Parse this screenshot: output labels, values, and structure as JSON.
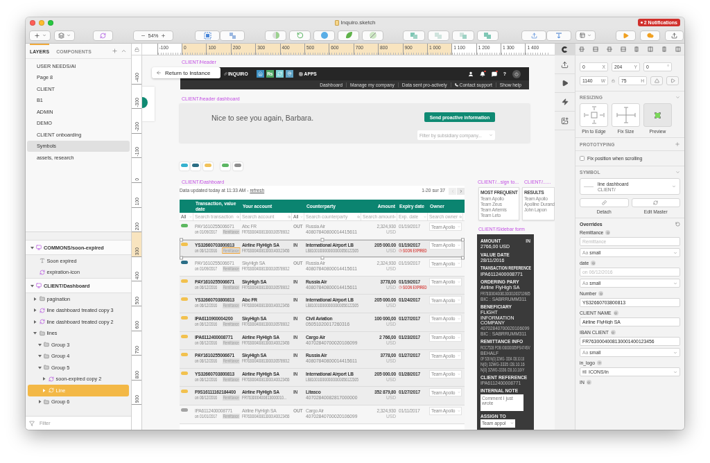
{
  "window": {
    "title": "Inquiro.sketch",
    "notifications": "2 Notifications"
  },
  "toolbar": {
    "zoom": "54%"
  },
  "layers_panel": {
    "tabs": [
      {
        "label": "LAYERS",
        "selected": true
      },
      {
        "label": "COMPONENTS",
        "selected": false
      }
    ],
    "pages": [
      {
        "label": "USER NEEDS/AI",
        "selected": false
      },
      {
        "label": "Page 8",
        "selected": false
      },
      {
        "label": "CLIENT",
        "selected": false
      },
      {
        "label": "B1",
        "selected": false
      },
      {
        "label": "ADMIN",
        "selected": false
      },
      {
        "label": "DEMO",
        "selected": false
      },
      {
        "label": "CLIENT onboarding",
        "selected": false
      },
      {
        "label": "Symbols",
        "selected": true
      },
      {
        "label": "assets, research",
        "selected": false
      }
    ],
    "layers": [
      {
        "label": "COMMONS/soon-expired",
        "kind": "artboard",
        "expanded": true,
        "selected": false,
        "children": [
          {
            "label": "Soon expired",
            "kind": "text",
            "selected": false
          },
          {
            "label": "expiration-icon",
            "kind": "symbol",
            "selected": false
          }
        ]
      },
      {
        "label": "CLIENT/Dashboard",
        "kind": "artboard",
        "expanded": true,
        "selected": false,
        "children": [
          {
            "label": "pagination",
            "kind": "group",
            "expanded": false,
            "selected": false
          },
          {
            "label": "line dashboard treated copy 3",
            "kind": "symbol",
            "expanded": false,
            "selected": false
          },
          {
            "label": "line dashboard treated copy 2",
            "kind": "symbol",
            "expanded": false,
            "selected": false
          },
          {
            "label": "lines",
            "kind": "group",
            "expanded": true,
            "selected": false,
            "children": [
              {
                "label": "Group 3",
                "kind": "group",
                "expanded": true,
                "selected": false
              },
              {
                "label": "Group 4",
                "kind": "group",
                "expanded": true,
                "selected": false
              },
              {
                "label": "Group 5",
                "kind": "group",
                "expanded": true,
                "selected": false,
                "children": [
                  {
                    "label": "soon-expired copy 2",
                    "kind": "symbol",
                    "expanded": false,
                    "selected": false
                  },
                  {
                    "label": "Line",
                    "kind": "symbol",
                    "expanded": false,
                    "selected": true
                  }
                ]
              },
              {
                "label": "Group 6",
                "kind": "group",
                "expanded": false,
                "selected": false
              }
            ]
          }
        ]
      }
    ],
    "filter": {
      "placeholder": "Filter"
    }
  },
  "rulers": {
    "horizontal": [
      {
        "label": "-100",
        "highlighted": false
      },
      {
        "label": "0",
        "highlighted": true
      },
      {
        "label": "100",
        "highlighted": true
      },
      {
        "label": "200",
        "highlighted": true
      },
      {
        "label": "300",
        "highlighted": true
      },
      {
        "label": "400",
        "highlighted": true
      },
      {
        "label": "500",
        "highlighted": true
      },
      {
        "label": "600",
        "highlighted": true
      },
      {
        "label": "700",
        "highlighted": true
      },
      {
        "label": "800",
        "highlighted": true
      },
      {
        "label": "900",
        "highlighted": true
      },
      {
        "label": "1 000",
        "highlighted": true
      },
      {
        "label": "1 100",
        "highlighted": false
      },
      {
        "label": "1 200",
        "highlighted": false
      },
      {
        "label": "1 300",
        "highlighted": false
      },
      {
        "label": "1 400",
        "highlighted": false
      }
    ],
    "vertical": [
      {
        "label": "-400",
        "highlighted": false
      },
      {
        "label": "-300",
        "highlighted": false
      },
      {
        "label": "-200",
        "highlighted": false
      },
      {
        "label": "-100",
        "highlighted": false
      },
      {
        "label": "0",
        "highlighted": false
      },
      {
        "label": "100",
        "highlighted": false
      },
      {
        "label": "200",
        "highlighted": false
      },
      {
        "label": "300",
        "highlighted": true
      },
      {
        "label": "400",
        "highlighted": false
      },
      {
        "label": "500",
        "highlighted": false
      },
      {
        "label": "600",
        "highlighted": false
      },
      {
        "label": "700",
        "highlighted": false
      },
      {
        "label": "800",
        "highlighted": false
      },
      {
        "label": "900",
        "highlighted": false
      }
    ]
  },
  "canvas": {
    "return_button": "Return to Instance",
    "header": {
      "title": "CLIENT/Header",
      "logo": "INQUIRO",
      "apps": [
        {
          "kind": "home",
          "color": "#3b8fc2"
        },
        {
          "kind": "text",
          "label": "Rs",
          "color": "#4fa866"
        },
        {
          "kind": "cycle",
          "color": "#7dd0d6"
        },
        {
          "kind": "pin",
          "color": "#5fa2c4"
        }
      ],
      "apps_label": "APPS",
      "icons": [
        {
          "kind": "user",
          "dot": false
        },
        {
          "kind": "bell",
          "dot": true
        },
        {
          "kind": "chat",
          "dot": true
        },
        {
          "kind": "help",
          "label": "?",
          "dot": false
        },
        {
          "kind": "power",
          "dot": false
        }
      ],
      "nav": [
        {
          "label": "Dashboard",
          "kind": "link"
        },
        {
          "label": "Manage my company",
          "kind": "link"
        },
        {
          "label": "Data sent pro-actively",
          "kind": "link"
        },
        {
          "label": "Contact support",
          "kind": "phone"
        },
        {
          "label": "Show help",
          "kind": "link"
        }
      ]
    },
    "header_dashboard": {
      "title": "CLIENT/header dashboard",
      "greeting": "Nice to see you again, Barbara.",
      "button": "Send proactive information",
      "filter": {
        "placeholder": "Filter by subsidiary company..."
      }
    },
    "status_badges": [
      {
        "color": "#36b2cf"
      },
      {
        "color": "#2b6e84"
      },
      {
        "color": "#f1c25a"
      },
      {
        "color": "#5cb663"
      },
      {
        "color": "#8e8e8e"
      }
    ],
    "dashboard": {
      "title": "CLIENT/Dashboard",
      "updated": "Data updated today at 11:33 AM - ",
      "refresh": "refresh",
      "range": "1-20 sur 37",
      "columns": [
        {
          "label": "Transaction, value date",
          "kind": "text"
        },
        {
          "label": "Your account",
          "kind": "text"
        },
        {
          "label": "Counterparty",
          "kind": "text"
        },
        {
          "label": "Amount",
          "kind": "number"
        },
        {
          "label": "Expiry date",
          "kind": "text"
        },
        {
          "label": "Owner",
          "kind": "text"
        }
      ],
      "filters": [
        {
          "kind": "select",
          "value": "All"
        },
        {
          "kind": "search",
          "placeholder": "Search transaction"
        },
        {
          "kind": "search",
          "placeholder": "Search account"
        },
        {
          "kind": "select",
          "value": "All"
        },
        {
          "kind": "search",
          "placeholder": "Search counterparty"
        },
        {
          "kind": "search",
          "placeholder": "Search amount"
        },
        {
          "kind": "select",
          "placeholder": "Exp. date"
        },
        {
          "kind": "search",
          "placeholder": "Search owner"
        }
      ],
      "rows": [
        {
          "status": {
            "color": "#5cb860"
          },
          "dimmed": true,
          "selected": false,
          "number": "PAY1610255006671",
          "date": "on 01/09/2017",
          "tag": "Remittance",
          "tag_selected": false,
          "account": "Abc FR",
          "account_iban": "FR7630004008130001005789012",
          "direction": "OUT",
          "counterparty": "Russia Air",
          "counterparty_iban": "40807840800014415611",
          "amount": "2,324,930",
          "currency": "USD",
          "expiry": "01/19/2017",
          "owner": "Team Apollo"
        },
        {
          "status": {
            "color": "#f2c14e"
          },
          "dimmed": false,
          "selected": true,
          "number": "YS32660703800813",
          "date": "on 06/12/2016",
          "tag": "Remittance",
          "tag_selected": true,
          "account": "Airline FlyHigh SA",
          "account_iban": "FR7630004008130001400123456",
          "direction": "IN",
          "counterparty": "International Airport LB",
          "counterparty_iban": "LB81001000000000000056122305",
          "amount": "205 000.00",
          "currency": "USD",
          "expiry": "01/19/2017",
          "warning": "SOON EXPIRED",
          "owner": "Team Apollo"
        },
        {
          "status": {
            "color": "#2a6e86"
          },
          "dimmed": true,
          "selected": false,
          "number": "PAY1610255006671",
          "date": "on 01/09/2017",
          "tag": "Remittance",
          "tag_selected": false,
          "account": "SkyHigh SA",
          "account_iban": "FR7630004008130001005789012",
          "direction": "OUT",
          "counterparty": "Russia Air",
          "counterparty_iban": "40807840800014415611",
          "amount": "2,324,930",
          "currency": "USD",
          "expiry": "01/19/2017",
          "owner": "Team Apollo"
        },
        {
          "status": {
            "color": "#f2c14e"
          },
          "dimmed": false,
          "selected": false,
          "number": "PAY1610255006671",
          "date": "on 06/12/2016",
          "tag": "Remittance",
          "tag_selected": false,
          "account": "SkyHigh SA",
          "account_iban": "FR7630004008130001005789012",
          "direction": "IN",
          "counterparty": "Russia Air",
          "counterparty_iban": "40807840800014415611",
          "amount": "3778,00",
          "currency": "USD",
          "expiry": "01/19/2017",
          "warning": "SOON EXPIRED",
          "owner": "Team Apollo"
        },
        {
          "status": {
            "color": "#f2c14e"
          },
          "dimmed": false,
          "selected": false,
          "number": "YS32660703800813",
          "date": "on 06/12/2016",
          "tag": "Remittance",
          "tag_selected": false,
          "account": "Abc FR",
          "account_iban": "FR7630004008130001400123456",
          "direction": "IN",
          "counterparty": "International Airport LB",
          "counterparty_iban": "LB81001000000000000056122305",
          "amount": "205 000.00",
          "currency": "USD",
          "expiry": "01/24/2017",
          "owner": "Team Apollo"
        },
        {
          "status": {
            "color": "#f2c14e"
          },
          "dimmed": false,
          "selected": false,
          "number": "IPA6110900004200",
          "date": "on 06/12/2016",
          "tag": "Remittance",
          "tag_selected": false,
          "account": "SkyHigh SA",
          "account_iban": "FR7630004008130001005789012",
          "direction": "IN",
          "counterparty": "Civil Aviation",
          "counterparty_iban": "05051020017260316",
          "amount": "100 000,00",
          "currency": "USD",
          "expiry": "01/27/2017",
          "owner": "Team Apollo"
        },
        {
          "status": {
            "color": "#f2c14e"
          },
          "dimmed": false,
          "selected": false,
          "number": "IPA6112400008771",
          "date": "on 06/12/2016",
          "tag": "Remittance",
          "tag_selected": false,
          "account": "Airline FlyHigh SA",
          "account_iban": "FR7630004008130001400123456",
          "direction": "IN",
          "counterparty": "Cargo Air",
          "counterparty_iban": "40702840700020106099",
          "amount": "2 766,00",
          "currency": "USD",
          "expiry": "01/23/2017",
          "owner": "Team Apollo"
        },
        {
          "status": {
            "color": "#f2c14e"
          },
          "dimmed": false,
          "selected": false,
          "number": "PAY1610255006671",
          "date": "on 06/12/2016",
          "tag": "Remittance",
          "tag_selected": false,
          "account": "SkyHigh SA",
          "account_iban": "FR7630004008130001005789012",
          "direction": "IN",
          "counterparty": "Russia Air",
          "counterparty_iban": "40807840800014415611",
          "amount": "3778,00",
          "currency": "USD",
          "expiry": "01/27/2017",
          "owner": "Team Apollo"
        },
        {
          "status": {
            "color": "#f2c14e"
          },
          "dimmed": false,
          "selected": false,
          "number": "YS32660703800813",
          "date": "on 06/12/2016",
          "tag": "Remittance",
          "tag_selected": false,
          "account": "Airline FlyHigh SA",
          "account_iban": "FR7630004008130001400123456",
          "direction": "IN",
          "counterparty": "International Airport LB",
          "counterparty_iban": "LB81001000000000000056122305",
          "amount": "205 000.00",
          "currency": "USD",
          "expiry": "01/28/2017",
          "owner": "Team Apollo"
        },
        {
          "status": {
            "color": "#f2c14e"
          },
          "dimmed": false,
          "selected": false,
          "number": "F9S16111162184400",
          "date": "on 06/12/2016",
          "tag": "Remittance",
          "tag_selected": false,
          "account": "Airline FlyHigh SA",
          "account_iban": "FR763000400813000010...",
          "direction": "IN",
          "counterparty": "Litasco",
          "counterparty_iban": "40702840082817000000",
          "amount": "352 879,80",
          "currency": "USD",
          "expiry": "01/27/2017",
          "owner": "Team Apollo"
        },
        {
          "status": {
            "color": "#a3a3a3"
          },
          "dimmed": true,
          "selected": false,
          "number": "IPA6112400008771",
          "date": "on 01/01/2017",
          "tag": "Remittance",
          "tag_selected": false,
          "account": "Airline FlyHigh SA",
          "account_iban": "FR7630004008130001400123456",
          "direction": "OUT",
          "counterparty": "Cargo Air",
          "counterparty_iban": "40702840700020106099",
          "amount": "2,324,930",
          "currency": "USD",
          "expiry": "01/11/2017",
          "owner": "Team Apollo"
        }
      ]
    },
    "assign_dropdown": {
      "title": "CLIENT/...sign to...",
      "heading": "MOST FREQUENT",
      "items": [
        "Team Apollo",
        "Team Zeus",
        "Team Artemis",
        "Team Leto"
      ]
    },
    "search_results": {
      "title": "CLIENT/......",
      "heading": "RESULTS",
      "items": [
        "Team Apollo",
        "Apolline Durand",
        "John Lapon"
      ]
    },
    "sidebar_form": {
      "title": "CLIENT/Sidebar form",
      "direction": "IN",
      "fields": [
        {
          "label": "AMOUNT",
          "value": "2766,00 USD"
        },
        {
          "label": "VALUE DATE",
          "value": "28/11/2016"
        },
        {
          "label": "TRANSACTION REFERENCE",
          "value": "IPA6112400008771"
        },
        {
          "label": "ORDERING PARY",
          "value": "Airline FlyHigh SA",
          "details": [
            "FR7630004008130001003710985",
            "BIC : SABRRUMM311"
          ]
        },
        {
          "label": "BENEFICIARY",
          "value": "FLIGHT INFORMATION COMPANY",
          "details": [
            "40702840700020106099",
            "BIC : SABRRUMM311"
          ]
        },
        {
          "label": "REMITTANCE INFO",
          "details": [
            "ROC7528 POB /00000005/FS474SV",
            "BEHALF",
            "OF 526 N(0) 32WG- 3334 /28.10.16",
            "N(0) 32WG-3335 /28.10.16",
            "N(0) 32WG-3336 /28.10.16/Y"
          ]
        },
        {
          "label": "CLIENT REFERENCE",
          "details": [
            "IPA6112400008771"
          ]
        }
      ],
      "note": {
        "label": "INTERNAL NOTE",
        "value": "Comment I just wrote"
      },
      "assign": {
        "label": "ASSIGN TO",
        "value": "Team appol"
      }
    }
  },
  "inspector": {
    "position": [
      {
        "value": "0",
        "unit": "X"
      },
      {
        "value": "204",
        "unit": "Y"
      },
      {
        "value": "0",
        "unit": "°"
      }
    ],
    "size": [
      {
        "value": "1140",
        "unit": "W"
      },
      {
        "value": "75",
        "unit": "H"
      }
    ],
    "resizing": {
      "title": "RESIZING",
      "options": [
        "Pin to Edge",
        "Fix Size",
        "Preview"
      ]
    },
    "prototyping": {
      "title": "PROTOTYPING",
      "fix_position": {
        "label": "Fix position when scrolling",
        "checked": false
      }
    },
    "symbol": {
      "title": "SYMBOL",
      "name": "line dashboard",
      "path": "CLIENT/",
      "actions": [
        "Detach",
        "Edit Master"
      ]
    },
    "overrides": {
      "title": "Overrides",
      "items": [
        {
          "kind": "text",
          "label": "Remittance",
          "placeholder": "Remittance",
          "style": {
            "glyph": "Aa",
            "name": "small"
          }
        },
        {
          "kind": "text",
          "label": "date",
          "placeholder": "on 06/12/2016",
          "style": {
            "glyph": "Aa",
            "name": "small"
          }
        },
        {
          "kind": "text",
          "label": "Number",
          "value": "YS32660703800813"
        },
        {
          "kind": "text",
          "label": "CLIENT NAME",
          "value": "Airline FlyHigh SA"
        },
        {
          "kind": "text",
          "label": "IBAN CLIENT",
          "value": "FR7630004008130001400123456",
          "style": {
            "glyph": "Aa",
            "name": "small"
          }
        },
        {
          "kind": "symbol",
          "label": "in_logo",
          "value": "ICONS/in"
        },
        {
          "kind": "text",
          "label": "IN"
        }
      ]
    }
  }
}
